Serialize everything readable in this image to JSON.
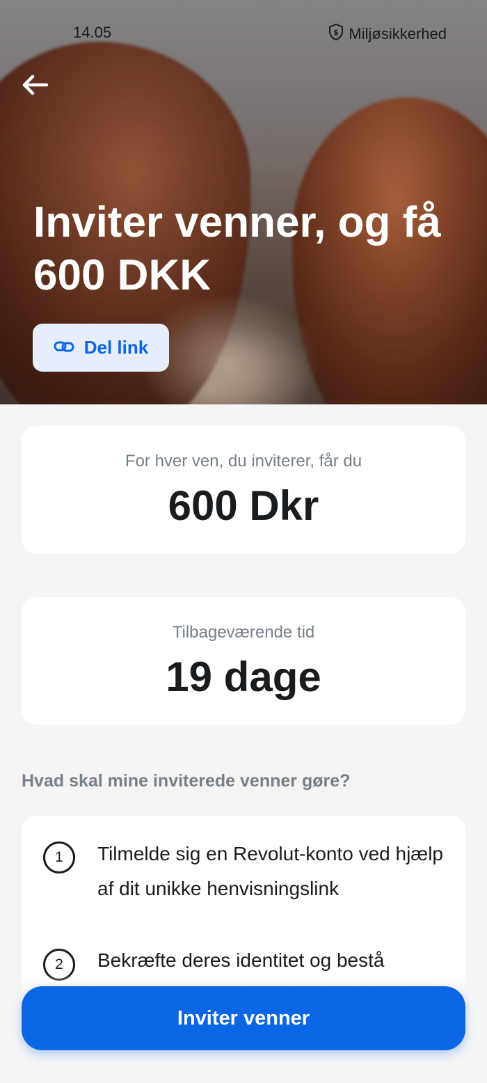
{
  "status_bar": {
    "time": "14.05",
    "security_label": "Miljøsikkerhed",
    "security_icon": "shield-dollar-icon"
  },
  "hero": {
    "back_icon": "arrow-left-icon",
    "title": "Inviter venner, og få 600 DKK",
    "share_button_label": "Del link",
    "share_icon": "link-icon"
  },
  "reward_card": {
    "caption": "For hver ven, du inviterer, får du",
    "value": "600 Dkr"
  },
  "time_card": {
    "caption": "Tilbageværende tid",
    "value": "19 dage"
  },
  "steps_section": {
    "heading": "Hvad skal mine inviterede venner gøre?",
    "steps": [
      {
        "number": "1",
        "text": "Tilmelde sig en Revolut-konto ved hjælp af dit unikke henvisningslink"
      },
      {
        "number": "2",
        "text": "Bekræfte deres identitet og bestå"
      }
    ]
  },
  "cta": {
    "label": "Inviter venner"
  },
  "colors": {
    "accent": "#0a66e4",
    "share_button_bg": "#e5eefa",
    "page_bg": "#f5f5f6",
    "muted_text": "#75808a"
  }
}
